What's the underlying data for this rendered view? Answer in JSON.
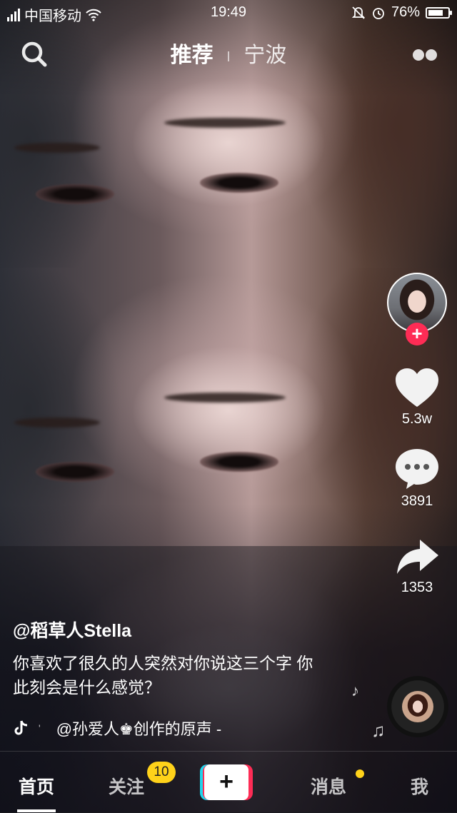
{
  "status_bar": {
    "carrier": "中国移动",
    "time": "19:49",
    "battery": "76%",
    "battery_level": 0.76
  },
  "top_nav": {
    "tab_recommend": "推荐",
    "tab_city": "宁波"
  },
  "right_rail": {
    "follow_plus": "+",
    "likes": "5.3w",
    "comments": "3891",
    "shares": "1353"
  },
  "post": {
    "author": "@稻草人Stella",
    "caption": "你喜欢了很久的人突然对你说这三个字 你此刻会是什么感觉？",
    "music": "@孙爱人♚创作的原声 -"
  },
  "bottom_bar": {
    "home": "首页",
    "following": "关注",
    "following_badge": "10",
    "add": "+",
    "messages": "消息",
    "me": "我"
  },
  "colors": {
    "accent_red": "#fe2c55",
    "accent_cyan": "#20d5ec",
    "badge_yellow": "#ffd21a"
  },
  "icons": [
    "search-icon",
    "more-dots-icon",
    "heart-icon",
    "comment-icon",
    "share-icon",
    "tiktok-logo-icon",
    "music-note-icon",
    "wifi-icon",
    "alarm-icon",
    "mute-icon"
  ]
}
